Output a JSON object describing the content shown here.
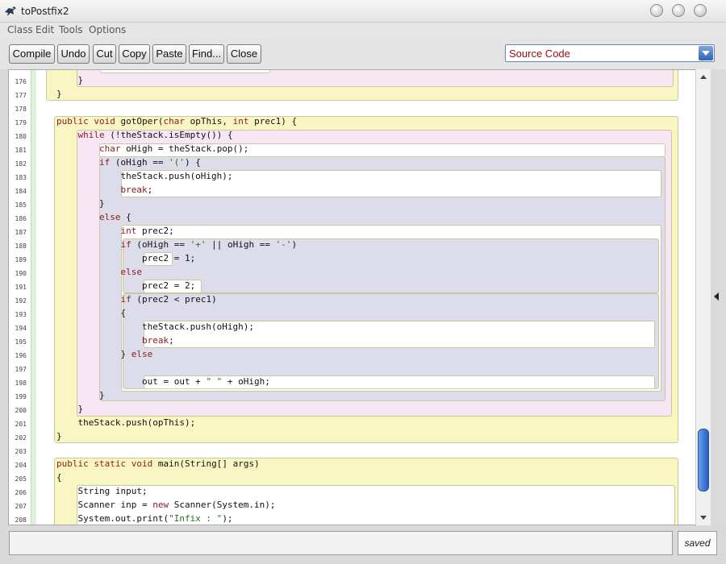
{
  "window": {
    "title": "toPostfix2"
  },
  "menu": [
    "Class",
    "Edit",
    "Tools",
    "Options"
  ],
  "toolbar": {
    "buttons": [
      "Compile",
      "Undo",
      "Cut",
      "Copy",
      "Paste",
      "Find...",
      "Close"
    ],
    "view_select": "Source Code"
  },
  "editor": {
    "line_numbers": [
      "176",
      "177",
      "178",
      "179",
      "180",
      "181",
      "182",
      "183",
      "184",
      "185",
      "186",
      "187",
      "188",
      "189",
      "190",
      "191",
      "192",
      "193",
      "194",
      "195",
      "196",
      "197",
      "198",
      "199",
      "200",
      "201",
      "202",
      "203",
      "204",
      "205",
      "206",
      "207",
      "208"
    ]
  },
  "status": {
    "message": "",
    "saved": "saved"
  },
  "colors": {
    "class_scope": "#faf6c4",
    "method_scope": "#f7e6f3",
    "block_scope": "#dcdcea",
    "keyword": "#8b1a1a",
    "string": "#1a7a1a",
    "scroll_thumb": "#3d78d6"
  }
}
